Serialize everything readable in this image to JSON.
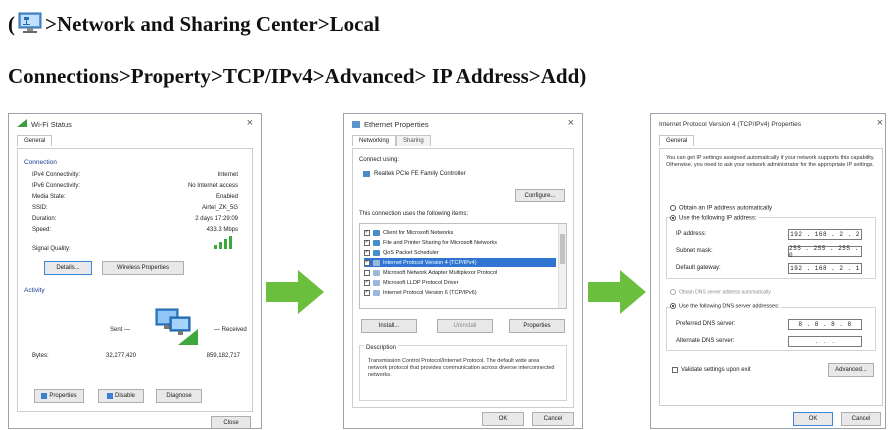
{
  "heading": {
    "line1_open": "(",
    "line1_text": ">Network and Sharing Center>Local",
    "line2_text": "Connections>Property>TCP/IPv4>Advanced> IP Address>Add)"
  },
  "icons": {
    "network_icon": "network-monitor-icon",
    "arrow": "green-right-arrow-icon",
    "wifi_signal": "wifi-signal-icon",
    "accent": "#6bbf3f"
  },
  "wifi_status": {
    "title": "Wi-Fi Status",
    "close": "×",
    "tab_general": "General",
    "connection_label": "Connection",
    "rows": [
      {
        "label": "IPv4 Connectivity:",
        "value": "Internet"
      },
      {
        "label": "IPv6 Connectivity:",
        "value": "No Internet access"
      },
      {
        "label": "Media State:",
        "value": "Enabled"
      },
      {
        "label": "SSID:",
        "value": "Airtel_ZK_5G"
      },
      {
        "label": "Duration:",
        "value": "2 days 17:29:09"
      },
      {
        "label": "Speed:",
        "value": "433.3 Mbps"
      }
    ],
    "signal_quality": "Signal Quality:",
    "details_btn": "Details...",
    "wireless_btn": "Wireless Properties",
    "activity_label": "Activity",
    "sent": "Sent",
    "received": "Received",
    "bytes_label": "Bytes:",
    "bytes_sent": "32,277,420",
    "bytes_received": "859,182,717",
    "properties_btn": "Properties",
    "disable_btn": "Disable",
    "diagnose_btn": "Diagnose",
    "close_btn": "Close"
  },
  "ethernet": {
    "title": "Ethernet Properties",
    "close": "×",
    "tab_networking": "Networking",
    "tab_sharing": "Sharing",
    "connect_using": "Connect using:",
    "adapter": "Realtek PCIe FE Family Controller",
    "configure_btn": "Configure...",
    "items_label": "This connection uses the following items:",
    "items": [
      {
        "label": "Client for Microsoft Networks",
        "checked": "✓"
      },
      {
        "label": "File and Printer Sharing for Microsoft Networks",
        "checked": "✓"
      },
      {
        "label": "QoS Packet Scheduler",
        "checked": "✓"
      },
      {
        "label": "Internet Protocol Version 4 (TCP/IPv4)",
        "checked": "✓"
      },
      {
        "label": "Microsoft Network Adapter Multiplexor Protocol",
        "checked": ""
      },
      {
        "label": "Microsoft LLDP Protocol Driver",
        "checked": "✓"
      },
      {
        "label": "Internet Protocol Version 6 (TCP/IPv6)",
        "checked": "✓"
      }
    ],
    "install_btn": "Install...",
    "uninstall_btn": "Uninstall",
    "properties_btn": "Properties",
    "description_label": "Description",
    "description": "Transmission Control Protocol/Internet Protocol. The default wide area network protocol that provides communication across diverse interconnected networks.",
    "ok_btn": "OK",
    "cancel_btn": "Cancel"
  },
  "tcpip": {
    "title": "Internet Protocol Version 4 (TCP/IPv4) Properties",
    "close": "×",
    "tab_general": "General",
    "intro": "You can get IP settings assigned automatically if your network supports this capability. Otherwise, you need to ask your network administrator for the appropriate IP settings.",
    "obtain_auto": "Obtain an IP address automatically",
    "use_following": "Use the following IP address:",
    "ip_label": "IP address:",
    "ip_value": "192 . 168 . 2 . 2",
    "subnet_label": "Subnet mask:",
    "subnet_value": "255 . 255 . 255 . 0",
    "gateway_label": "Default gateway:",
    "gateway_value": "192 . 168 . 2 . 1",
    "dns_auto": "Obtain DNS server address automatically",
    "dns_following": "Use the following DNS server addresses:",
    "preferred_label": "Preferred DNS server:",
    "preferred_value": "8 . 8 . 8 . 8",
    "alternate_label": "Alternate DNS server:",
    "alternate_value": ". . .",
    "validate": "Validate settings upon exit",
    "advanced_btn": "Advanced...",
    "ok_btn": "OK",
    "cancel_btn": "Cancel"
  }
}
